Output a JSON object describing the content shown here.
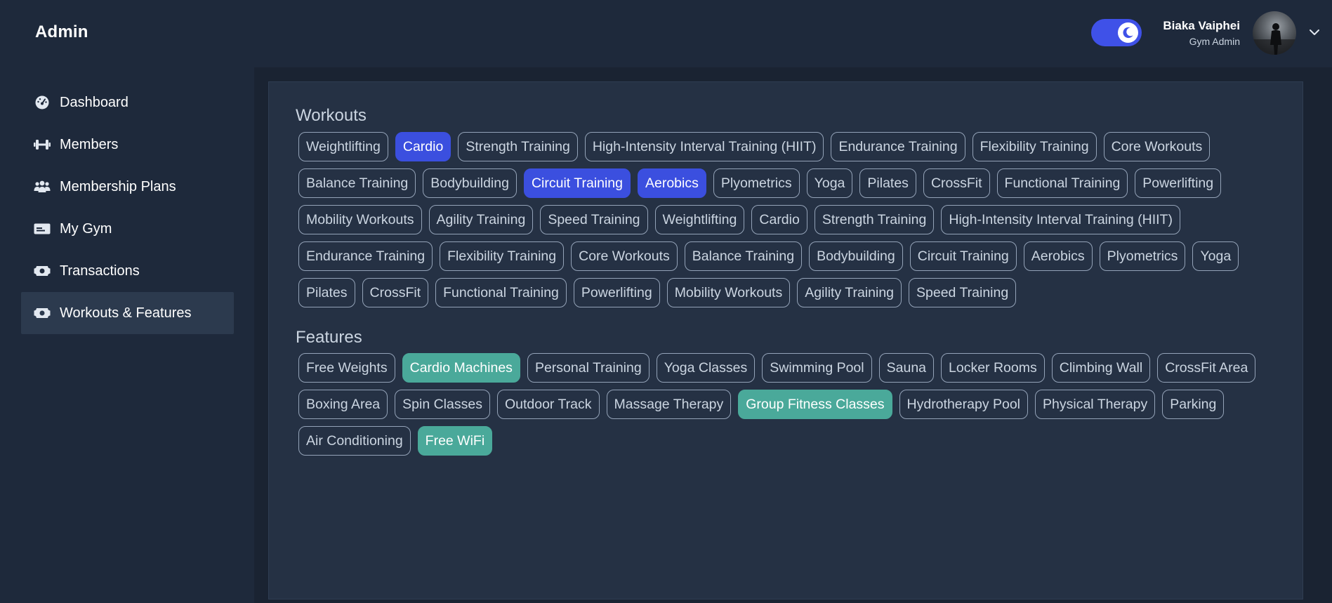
{
  "header": {
    "brand": "Admin",
    "theme_toggle": {
      "on": true,
      "icon": "moon-icon"
    },
    "user": {
      "name": "Biaka Vaiphei",
      "role": "Gym Admin"
    },
    "dropdown_icon": "chevron-down-icon"
  },
  "sidebar": {
    "items": [
      {
        "label": "Dashboard",
        "icon": "gauge-icon",
        "active": false
      },
      {
        "label": "Members",
        "icon": "dumbbell-icon",
        "active": false
      },
      {
        "label": "Membership Plans",
        "icon": "users-icon",
        "active": false
      },
      {
        "label": "My Gym",
        "icon": "id-card-icon",
        "active": false
      },
      {
        "label": "Transactions",
        "icon": "money-bill-icon",
        "active": false
      },
      {
        "label": "Workouts & Features",
        "icon": "money-bill-icon",
        "active": true
      }
    ]
  },
  "colors": {
    "workout_selected": "#3b4fdf",
    "feature_selected": "#4aa99a",
    "toggle_on": "#3f51e8"
  },
  "workouts": {
    "title": "Workouts",
    "items": [
      {
        "label": "Weightlifting",
        "selected": false
      },
      {
        "label": "Cardio",
        "selected": true
      },
      {
        "label": "Strength Training",
        "selected": false
      },
      {
        "label": "High-Intensity Interval Training (HIIT)",
        "selected": false
      },
      {
        "label": "Endurance Training",
        "selected": false
      },
      {
        "label": "Flexibility Training",
        "selected": false
      },
      {
        "label": "Core Workouts",
        "selected": false
      },
      {
        "label": "Balance Training",
        "selected": false
      },
      {
        "label": "Bodybuilding",
        "selected": false
      },
      {
        "label": "Circuit Training",
        "selected": true
      },
      {
        "label": "Aerobics",
        "selected": true
      },
      {
        "label": "Plyometrics",
        "selected": false
      },
      {
        "label": "Yoga",
        "selected": false
      },
      {
        "label": "Pilates",
        "selected": false
      },
      {
        "label": "CrossFit",
        "selected": false
      },
      {
        "label": "Functional Training",
        "selected": false
      },
      {
        "label": "Powerlifting",
        "selected": false
      },
      {
        "label": "Mobility Workouts",
        "selected": false
      },
      {
        "label": "Agility Training",
        "selected": false
      },
      {
        "label": "Speed Training",
        "selected": false
      },
      {
        "label": "Weightlifting",
        "selected": false
      },
      {
        "label": "Cardio",
        "selected": false
      },
      {
        "label": "Strength Training",
        "selected": false
      },
      {
        "label": "High-Intensity Interval Training (HIIT)",
        "selected": false
      },
      {
        "label": "Endurance Training",
        "selected": false
      },
      {
        "label": "Flexibility Training",
        "selected": false
      },
      {
        "label": "Core Workouts",
        "selected": false
      },
      {
        "label": "Balance Training",
        "selected": false
      },
      {
        "label": "Bodybuilding",
        "selected": false
      },
      {
        "label": "Circuit Training",
        "selected": false
      },
      {
        "label": "Aerobics",
        "selected": false
      },
      {
        "label": "Plyometrics",
        "selected": false
      },
      {
        "label": "Yoga",
        "selected": false
      },
      {
        "label": "Pilates",
        "selected": false
      },
      {
        "label": "CrossFit",
        "selected": false
      },
      {
        "label": "Functional Training",
        "selected": false
      },
      {
        "label": "Powerlifting",
        "selected": false
      },
      {
        "label": "Mobility Workouts",
        "selected": false
      },
      {
        "label": "Agility Training",
        "selected": false
      },
      {
        "label": "Speed Training",
        "selected": false
      }
    ]
  },
  "features": {
    "title": "Features",
    "items": [
      {
        "label": "Free Weights",
        "selected": false
      },
      {
        "label": "Cardio Machines",
        "selected": true
      },
      {
        "label": "Personal Training",
        "selected": false
      },
      {
        "label": "Yoga Classes",
        "selected": false
      },
      {
        "label": "Swimming Pool",
        "selected": false
      },
      {
        "label": "Sauna",
        "selected": false
      },
      {
        "label": "Locker Rooms",
        "selected": false
      },
      {
        "label": "Climbing Wall",
        "selected": false
      },
      {
        "label": "CrossFit Area",
        "selected": false
      },
      {
        "label": "Boxing Area",
        "selected": false
      },
      {
        "label": "Spin Classes",
        "selected": false
      },
      {
        "label": "Outdoor Track",
        "selected": false
      },
      {
        "label": "Massage Therapy",
        "selected": false
      },
      {
        "label": "Group Fitness Classes",
        "selected": true
      },
      {
        "label": "Hydrotherapy Pool",
        "selected": false
      },
      {
        "label": "Physical Therapy",
        "selected": false
      },
      {
        "label": "Parking",
        "selected": false
      },
      {
        "label": "Air Conditioning",
        "selected": false
      },
      {
        "label": "Free WiFi",
        "selected": true
      }
    ]
  }
}
